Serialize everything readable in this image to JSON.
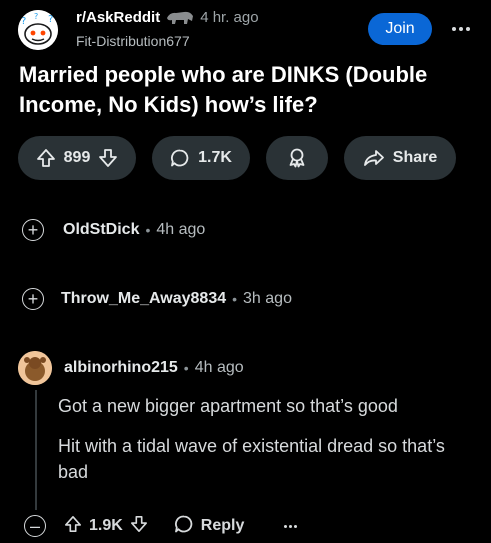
{
  "post": {
    "subreddit": "r/AskReddit",
    "time": "4 hr. ago",
    "author": "Fit-Distribution677",
    "join_label": "Join",
    "title": "Married people who are DINKS (Double Income, No Kids) how’s life?",
    "votes": "899",
    "comments": "1.7K",
    "share_label": "Share"
  },
  "collapsed_comments": [
    {
      "author": "OldStDick",
      "time": "4h ago"
    },
    {
      "author": "Throw_Me_Away8834",
      "time": "3h ago"
    }
  ],
  "comment": {
    "author": "albinorhino215",
    "time": "4h ago",
    "paragraphs": [
      "Got a new bigger apartment so that’s good",
      "Hit with a tidal wave of existential dread so that’s bad"
    ],
    "votes": "1.9K",
    "reply_label": "Reply"
  },
  "separator": "•",
  "colors": {
    "accent": "#0a67d6",
    "pill_bg": "#2a3236",
    "background": "#000000"
  },
  "icons": [
    "snoo-avatar-icon",
    "upvote-icon",
    "downvote-icon",
    "comment-icon",
    "award-icon",
    "share-icon",
    "expand-icon",
    "collapse-icon",
    "more-icon",
    "user-avatar-icon"
  ]
}
